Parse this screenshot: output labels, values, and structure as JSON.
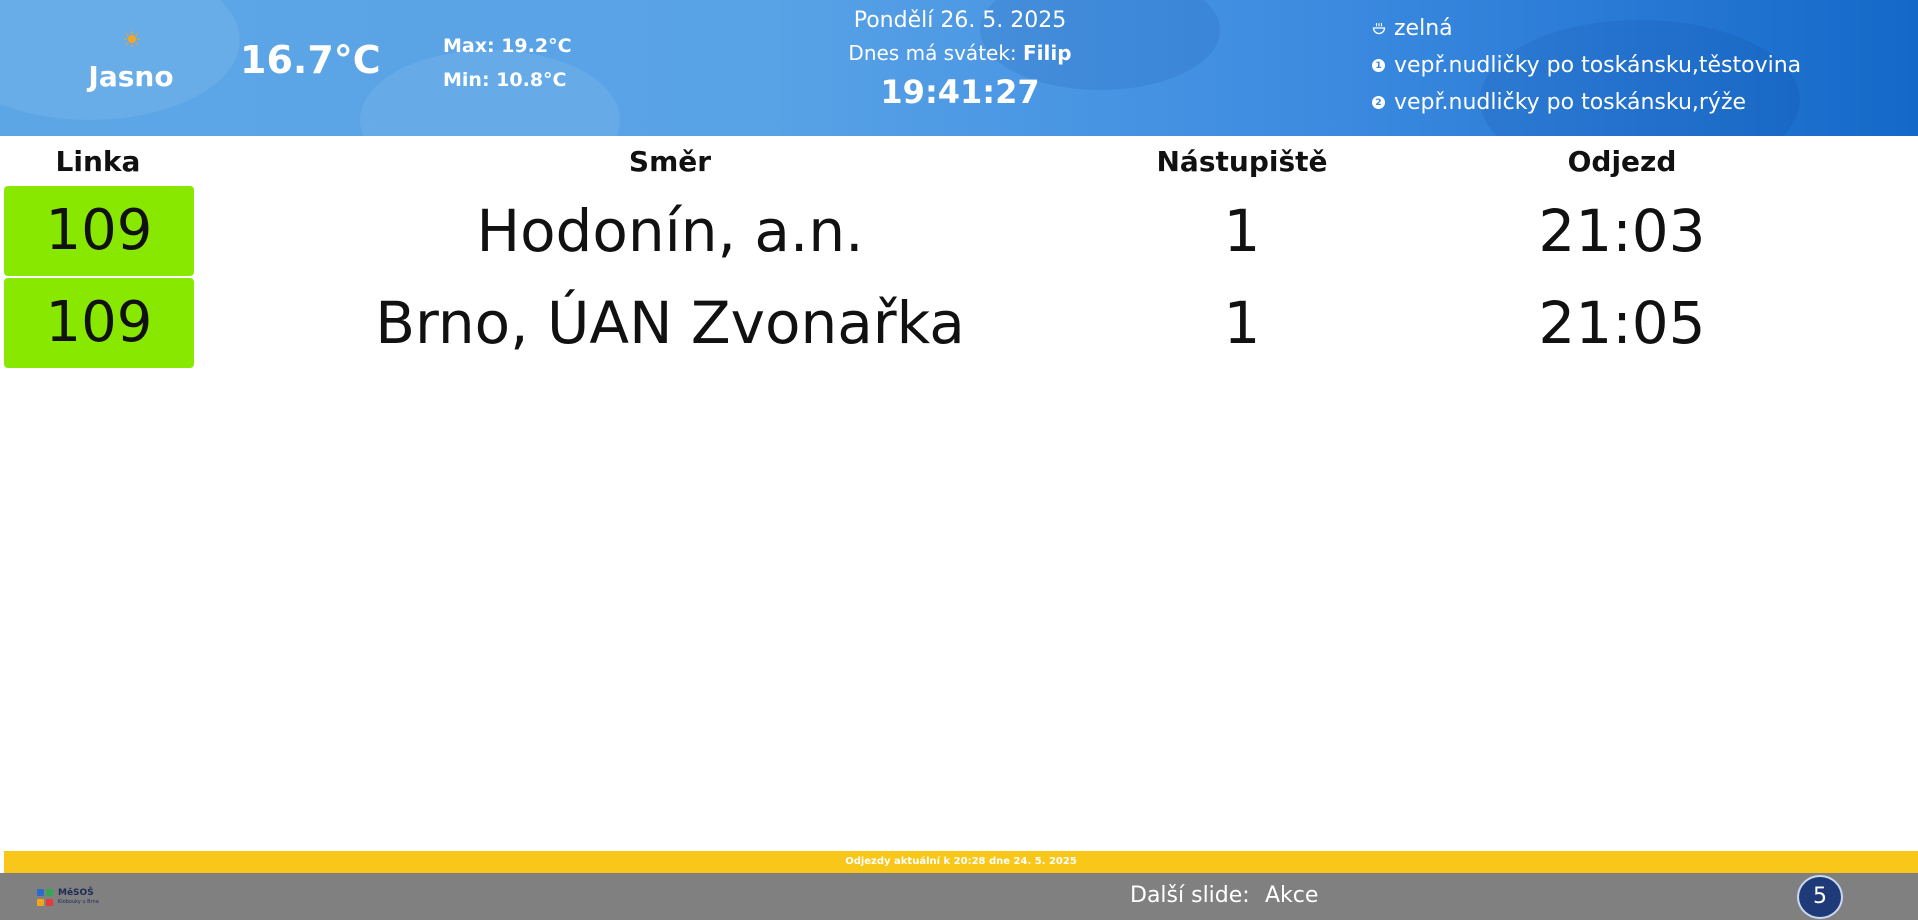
{
  "weather": {
    "condition": "Jasno",
    "temperature": "16.7°C",
    "max": "Max: 19.2°C",
    "min": "Min: 10.8°C",
    "icon": "sun-icon",
    "icon_color": "#f5a623"
  },
  "datetime": {
    "date": "Pondělí 26. 5. 2025",
    "nameday_label": "Dnes má svátek:",
    "nameday_name": "Filip",
    "time": "19:41:27"
  },
  "menu": [
    {
      "icon": "soup-icon",
      "text": "zelná"
    },
    {
      "icon": "number-1-icon",
      "num": "1",
      "text": "vepř.nudličky po toskánsku,těstovina"
    },
    {
      "icon": "number-2-icon",
      "num": "2",
      "text": "vepř.nudličky po toskánsku,rýže"
    }
  ],
  "table": {
    "headers": {
      "line": "Linka",
      "direction": "Směr",
      "platform": "Nástupiště",
      "departure": "Odjezd"
    },
    "rows": [
      {
        "line": "109",
        "direction": "Hodonín, a.n.",
        "platform": "1",
        "departure": "21:03"
      },
      {
        "line": "109",
        "direction": "Brno, ÚAN Zvonařka",
        "platform": "1",
        "departure": "21:05"
      }
    ]
  },
  "footer": {
    "update_prefix": "Odjezdy aktuální k",
    "update_time": "20:28",
    "update_suffix": "dne 24. 5. 2025",
    "logo_text": "MěSOŠ",
    "logo_sub": "Klobouky u Brna",
    "next_label": "Další slide:",
    "next_value": "Akce",
    "counter": "5"
  },
  "colors": {
    "line_badge": "#88e800",
    "update_bar": "#f9c71a",
    "footer": "#808080",
    "counter_bg": "#1e3a78"
  }
}
